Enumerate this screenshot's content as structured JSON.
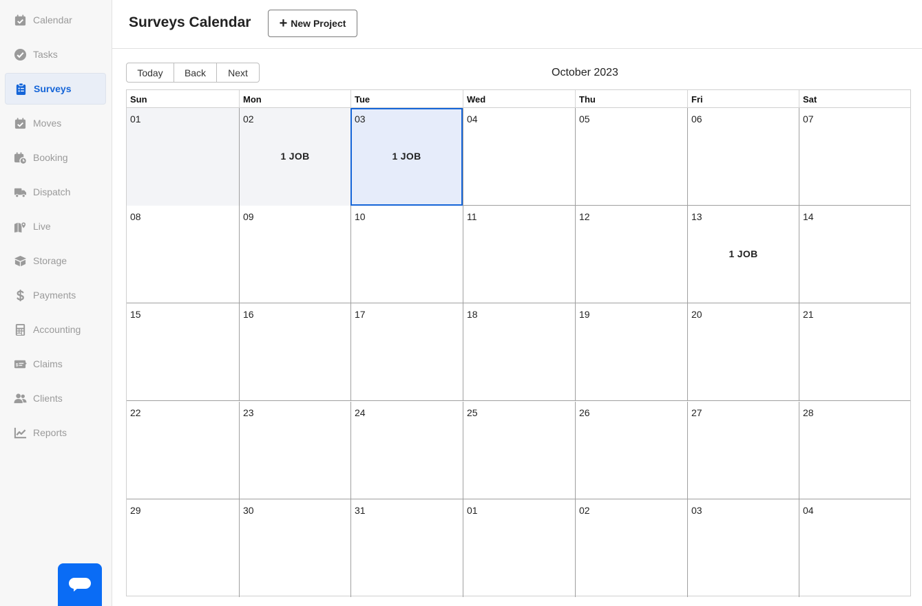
{
  "sidebar": {
    "items": [
      {
        "label": "Calendar",
        "icon": "calendar-check-icon",
        "active": false
      },
      {
        "label": "Tasks",
        "icon": "check-circle-icon",
        "active": false
      },
      {
        "label": "Surveys",
        "icon": "clipboard-list-icon",
        "active": true
      },
      {
        "label": "Moves",
        "icon": "calendar-check-icon",
        "active": false
      },
      {
        "label": "Booking",
        "icon": "calendar-clock-icon",
        "active": false
      },
      {
        "label": "Dispatch",
        "icon": "truck-icon",
        "active": false
      },
      {
        "label": "Live",
        "icon": "map-marker-icon",
        "active": false
      },
      {
        "label": "Storage",
        "icon": "box-icon",
        "active": false
      },
      {
        "label": "Payments",
        "icon": "dollar-icon",
        "active": false
      },
      {
        "label": "Accounting",
        "icon": "calculator-icon",
        "active": false
      },
      {
        "label": "Claims",
        "icon": "money-check-icon",
        "active": false
      },
      {
        "label": "Clients",
        "icon": "users-icon",
        "active": false
      },
      {
        "label": "Reports",
        "icon": "chart-line-icon",
        "active": false
      }
    ]
  },
  "header": {
    "title": "Surveys Calendar",
    "new_project_label": "New Project"
  },
  "toolbar": {
    "today_label": "Today",
    "back_label": "Back",
    "next_label": "Next",
    "month_label": "October 2023"
  },
  "calendar": {
    "weekdays": [
      "Sun",
      "Mon",
      "Tue",
      "Wed",
      "Thu",
      "Fri",
      "Sat"
    ],
    "weeks": [
      [
        {
          "day": "01",
          "off": true
        },
        {
          "day": "02",
          "off": true,
          "jobs": "1 JOB"
        },
        {
          "day": "03",
          "selected": true,
          "jobs": "1 JOB"
        },
        {
          "day": "04"
        },
        {
          "day": "05"
        },
        {
          "day": "06"
        },
        {
          "day": "07"
        }
      ],
      [
        {
          "day": "08"
        },
        {
          "day": "09"
        },
        {
          "day": "10"
        },
        {
          "day": "11"
        },
        {
          "day": "12"
        },
        {
          "day": "13",
          "jobs": "1 JOB"
        },
        {
          "day": "14"
        }
      ],
      [
        {
          "day": "15"
        },
        {
          "day": "16"
        },
        {
          "day": "17"
        },
        {
          "day": "18"
        },
        {
          "day": "19"
        },
        {
          "day": "20"
        },
        {
          "day": "21"
        }
      ],
      [
        {
          "day": "22"
        },
        {
          "day": "23"
        },
        {
          "day": "24"
        },
        {
          "day": "25"
        },
        {
          "day": "26"
        },
        {
          "day": "27"
        },
        {
          "day": "28"
        }
      ],
      [
        {
          "day": "29"
        },
        {
          "day": "30"
        },
        {
          "day": "31"
        },
        {
          "day": "01"
        },
        {
          "day": "02"
        },
        {
          "day": "03"
        },
        {
          "day": "04"
        }
      ]
    ]
  },
  "colors": {
    "accent": "#1565d8",
    "chat_button": "#0a6cf5",
    "selected_day_bg": "#e6ecfa",
    "off_day_bg": "#f3f4f7"
  }
}
